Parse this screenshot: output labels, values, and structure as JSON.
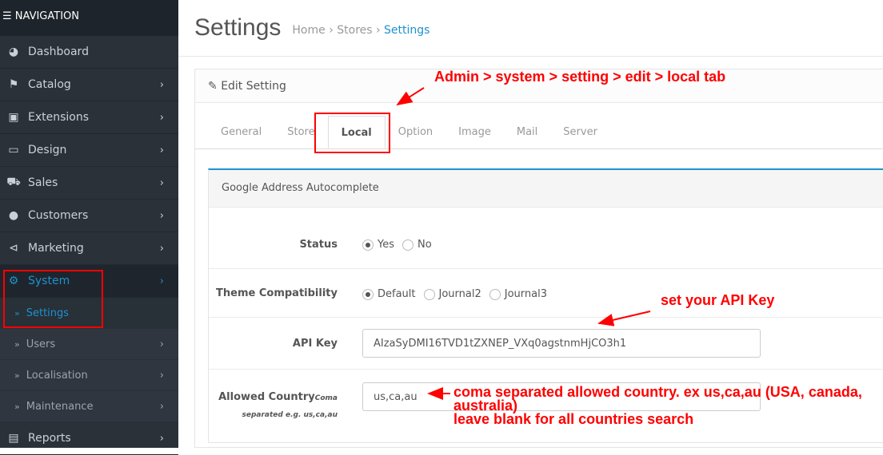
{
  "sidebar": {
    "header": "NAVIGATION",
    "items": [
      {
        "label": "Dashboard",
        "icon": "dashboard-icon"
      },
      {
        "label": "Catalog",
        "icon": "tag-icon"
      },
      {
        "label": "Extensions",
        "icon": "puzzle-icon"
      },
      {
        "label": "Design",
        "icon": "monitor-icon"
      },
      {
        "label": "Sales",
        "icon": "cart-icon"
      },
      {
        "label": "Customers",
        "icon": "user-icon"
      },
      {
        "label": "Marketing",
        "icon": "share-icon"
      },
      {
        "label": "System",
        "icon": "gear-icon"
      }
    ],
    "system_sub": [
      "Settings",
      "Users",
      "Localisation",
      "Maintenance"
    ],
    "reports": "Reports"
  },
  "header": {
    "title": "Settings",
    "breadcrumb": [
      "Home",
      "Stores",
      "Settings"
    ]
  },
  "panel": {
    "title": "Edit Setting",
    "tabs": [
      "General",
      "Store",
      "Local",
      "Option",
      "Image",
      "Mail",
      "Server"
    ],
    "active_tab": "Local"
  },
  "section": {
    "title": "Google Address Autocomplete",
    "status": {
      "label": "Status",
      "options": [
        "Yes",
        "No"
      ],
      "selected": "Yes"
    },
    "theme": {
      "label": "Theme Compatibility",
      "options": [
        "Default",
        "Journal2",
        "Journal3"
      ],
      "selected": "Default"
    },
    "api_key": {
      "label": "API Key",
      "value": "AIzaSyDMI16TVD1tZXNEP_VXq0agstnmHjCO3h1"
    },
    "allowed": {
      "label": "Allowed Country",
      "hint1": "Coma",
      "hint2": "separated e.g. us,ca,au",
      "value": "us,ca,au"
    }
  },
  "annotations": {
    "tab": "Admin > system > setting > edit > local tab",
    "api": "set your API Key",
    "country1": "coma separated allowed country. ex us,ca,au (USA, canada,",
    "country2": "australia)",
    "country3": "leave blank for all countries search"
  },
  "colors": {
    "accent": "#1e91cf",
    "annotation": "#ff0000",
    "sidebar": "#2b3139"
  }
}
